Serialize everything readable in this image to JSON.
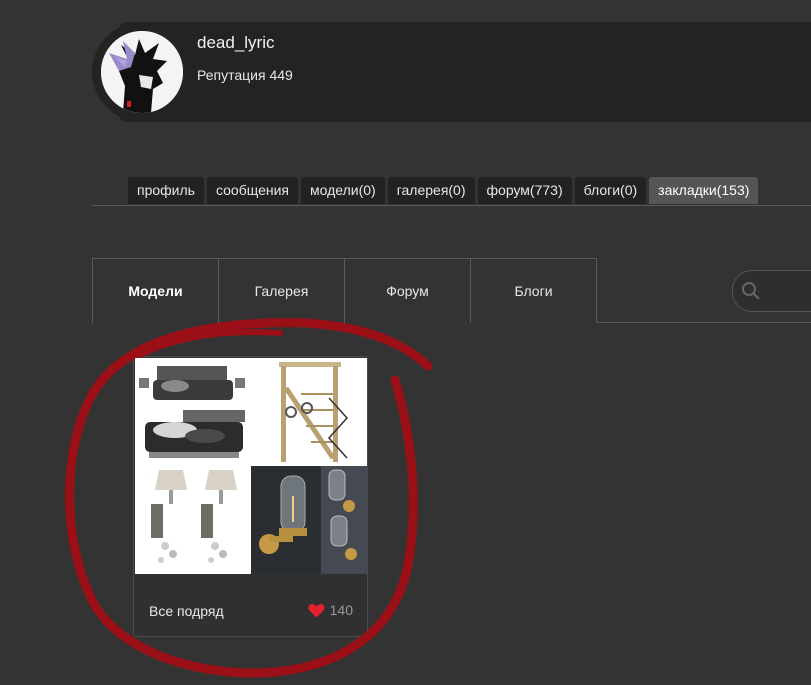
{
  "profile": {
    "username": "dead_lyric",
    "reputation": "Репутация 449"
  },
  "top_tabs": [
    {
      "label": "профиль"
    },
    {
      "label": "сообщения"
    },
    {
      "label": "модели(0)"
    },
    {
      "label": "галерея(0)"
    },
    {
      "label": "форум(773)"
    },
    {
      "label": "блоги(0)"
    },
    {
      "label": "закладки(153)",
      "active": true
    }
  ],
  "sub_tabs": [
    {
      "label": "Модели",
      "active": true
    },
    {
      "label": "Галерея"
    },
    {
      "label": "Форум"
    },
    {
      "label": "Блоги"
    }
  ],
  "card": {
    "title": "Все подряд",
    "likes": "140"
  },
  "colors": {
    "background": "#333333",
    "panel": "#232323",
    "active_tab": "#555555",
    "annotation": "#9b1016",
    "heart": "#e3222c"
  },
  "icons": [
    "search-icon",
    "heart-icon",
    "avatar-image"
  ]
}
